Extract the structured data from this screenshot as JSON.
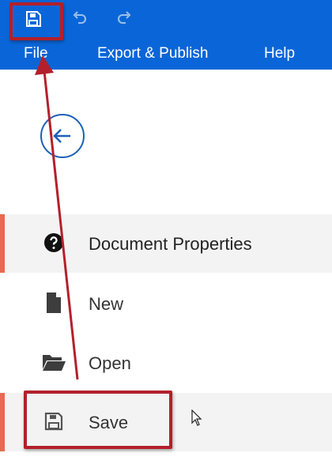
{
  "quick_access": {
    "save": "save-icon",
    "undo": "undo-icon",
    "redo": "redo-icon"
  },
  "menu": {
    "file": "File",
    "export_publish": "Export & Publish",
    "help": "Help"
  },
  "back_button": {
    "icon": "arrow-left-icon"
  },
  "nav": {
    "items": [
      {
        "label": "Document Properties",
        "icon": "question-circle-icon",
        "active": true
      },
      {
        "label": "New",
        "icon": "document-icon",
        "active": false
      },
      {
        "label": "Open",
        "icon": "folder-open-icon",
        "active": false
      },
      {
        "label": "Save",
        "icon": "save-icon",
        "active": true
      }
    ]
  },
  "colors": {
    "topbar": "#0a66d8",
    "accent": "#e86a4f",
    "callout": "#b3202b",
    "back_circle": "#1d5fb8"
  }
}
